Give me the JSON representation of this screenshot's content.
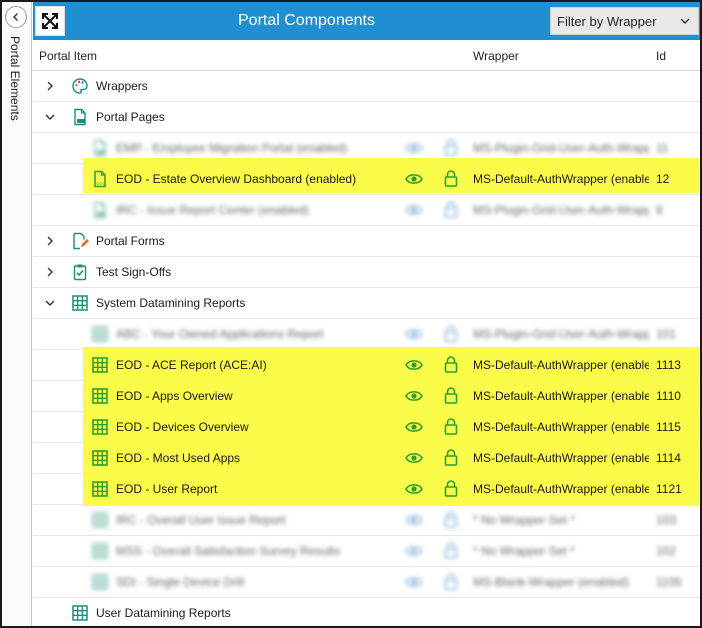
{
  "rail": {
    "label": "Portal Elements"
  },
  "titlebar": {
    "title": "Portal Components",
    "filter_label": "Filter by Wrapper"
  },
  "columns": {
    "item": "Portal Item",
    "wrapper": "Wrapper",
    "id": "Id"
  },
  "colors": {
    "accent": "#1f8fd1",
    "highlight": "#fbfb4a",
    "icon_teal": "#1a8f7a",
    "icon_green": "#2da02d",
    "icon_orange": "#e07020"
  },
  "rows": [
    {
      "type": "category",
      "label": "Wrappers",
      "expanded": false,
      "icon": "palette-icon"
    },
    {
      "type": "category",
      "label": "Portal Pages",
      "expanded": true,
      "icon": "page-icon"
    },
    {
      "type": "item",
      "label": "EMP - Employee Migration Portal (enabled)",
      "wrapper": "MS-Plugin-Grid-User-Auth-Wrapper",
      "id": "11",
      "blurred": true,
      "icon": "page-icon"
    },
    {
      "type": "item",
      "label": "EOD - Estate Overview Dashboard (enabled)",
      "wrapper": "MS-Default-AuthWrapper (enabled)",
      "id": "12",
      "highlight": true,
      "icon": "page-icon"
    },
    {
      "type": "item",
      "label": "IRC - Issue Report Center (enabled)",
      "wrapper": "MS-Plugin-Grid-User-Auth-Wrapper",
      "id": "8",
      "blurred": true,
      "icon": "page-icon"
    },
    {
      "type": "category",
      "label": "Portal Forms",
      "expanded": false,
      "icon": "form-icon"
    },
    {
      "type": "category",
      "label": "Test Sign-Offs",
      "expanded": false,
      "icon": "clipboard-check-icon"
    },
    {
      "type": "category",
      "label": "System Datamining Reports",
      "expanded": true,
      "icon": "grid-icon"
    },
    {
      "type": "item",
      "label": "ABC - Your Owned Applications Report",
      "wrapper": "MS-Plugin-Grid-User-Auth-Wrapper",
      "id": "101",
      "blurred": true,
      "icon": "grid-icon"
    },
    {
      "type": "item",
      "label": "EOD - ACE Report (ACE:AI)",
      "wrapper": "MS-Default-AuthWrapper (enabled)",
      "id": "1113",
      "highlight": true,
      "icon": "grid-icon"
    },
    {
      "type": "item",
      "label": "EOD - Apps Overview",
      "wrapper": "MS-Default-AuthWrapper (enabled)",
      "id": "1110",
      "highlight": true,
      "icon": "grid-icon"
    },
    {
      "type": "item",
      "label": "EOD - Devices Overview",
      "wrapper": "MS-Default-AuthWrapper (enabled)",
      "id": "1115",
      "highlight": true,
      "icon": "grid-icon"
    },
    {
      "type": "item",
      "label": "EOD - Most Used Apps",
      "wrapper": "MS-Default-AuthWrapper (enabled)",
      "id": "1114",
      "highlight": true,
      "icon": "grid-icon"
    },
    {
      "type": "item",
      "label": "EOD - User Report",
      "wrapper": "MS-Default-AuthWrapper (enabled)",
      "id": "1121",
      "highlight": true,
      "icon": "grid-icon"
    },
    {
      "type": "item",
      "label": "IRC - Overall User Issue Report",
      "wrapper": "* No Wrapper Set *",
      "id": "103",
      "blurred": true,
      "icon": "grid-icon"
    },
    {
      "type": "item",
      "label": "MSS - Overall Satisfaction Survey Results",
      "wrapper": "* No Wrapper Set *",
      "id": "102",
      "blurred": true,
      "icon": "grid-icon"
    },
    {
      "type": "item",
      "label": "SDI - Single Device Drill",
      "wrapper": "MS-Blank-Wrapper (enabled)",
      "id": "1105",
      "blurred": true,
      "icon": "grid-icon"
    },
    {
      "type": "category",
      "label": "User Datamining Reports",
      "expanded": null,
      "icon": "grid-icon"
    }
  ]
}
